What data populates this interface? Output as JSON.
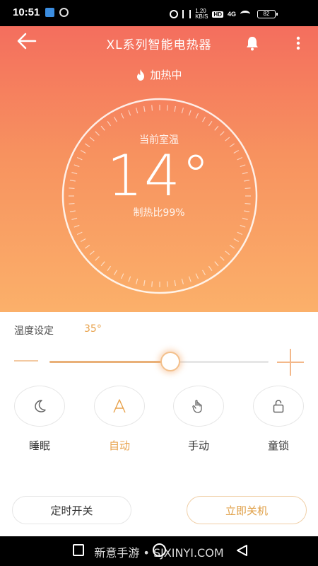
{
  "status_bar": {
    "time": "10:51",
    "speed_line1": "1.20",
    "speed_line2": "KB/S",
    "hd": "HD",
    "network": "4G",
    "battery": "82"
  },
  "header": {
    "title": "XL系列智能电热器",
    "back_icon": "arrow-left-icon",
    "bell_icon": "bell-icon",
    "more_icon": "more-vertical-icon"
  },
  "status": {
    "heating_text": "加热中",
    "flame_icon": "flame-icon"
  },
  "dial": {
    "label": "当前室温",
    "temperature": "14°",
    "ratio_text": "制热比99%"
  },
  "settings": {
    "label": "温度设定",
    "value": "35°",
    "slider_fraction": 0.55
  },
  "modes": [
    {
      "label": "睡眠",
      "icon": "moon-icon",
      "glyph": "☾",
      "active": false
    },
    {
      "label": "自动",
      "icon": "auto-icon",
      "glyph": "A",
      "active": true
    },
    {
      "label": "手动",
      "icon": "hand-icon",
      "glyph": "☜",
      "active": false
    },
    {
      "label": "童锁",
      "icon": "lock-icon",
      "glyph": "🔒",
      "active": false
    }
  ],
  "actions": {
    "timer_label": "定时开关",
    "shutdown_label": "立即关机"
  },
  "nav": {
    "watermark": "新意手游 • SJXINYI.COM"
  },
  "colors": {
    "accent": "#e8a24c",
    "gradient_top": "#f46e5e",
    "gradient_bottom": "#fbb06a"
  }
}
